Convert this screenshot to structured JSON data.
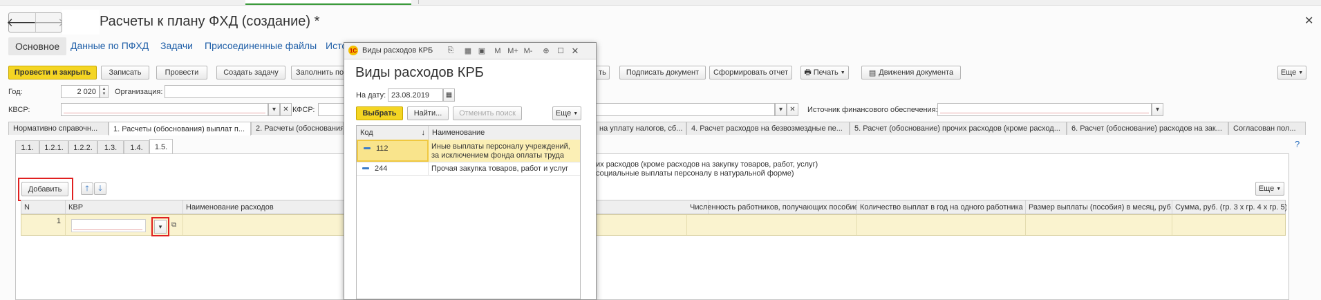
{
  "window": {
    "title": "Расчеты к плану ФХД (создание) *",
    "close_icon": "close-icon"
  },
  "nav": {
    "back": "🡐",
    "forward": "🡒"
  },
  "page_tabs": [
    {
      "label": "Основное",
      "active": true
    },
    {
      "label": "Данные по ПФХД"
    },
    {
      "label": "Задачи"
    },
    {
      "label": "Присоединенные файлы"
    },
    {
      "label": "Исто"
    }
  ],
  "toolbar": {
    "post_close": "Провести и закрыть",
    "save": "Записать",
    "post": "Провести",
    "create_task": "Создать задачу",
    "fill": "Заполнить по",
    "hidden_tail": "ть",
    "sign": "Подписать документ",
    "report": "Сформировать отчет",
    "print": "Печать",
    "movements": "Движения документа",
    "more": "Еще"
  },
  "form": {
    "year_label": "Год:",
    "year_value": "2 020",
    "org_label": "Организация:",
    "kvsr_label": "КВСР:",
    "kfsr_label": "КФСР:",
    "source_label": "Источник финансового обеспечения:"
  },
  "doc_tabs": [
    "Нормативно справочн...",
    "1. Расчеты (обоснования) выплат п...",
    "2. Расчеты (обоснования)",
    "на уплату налогов, сб...",
    "4. Расчет расходов на безвозмездные пе...",
    "5. Расчет (обоснование) прочих расходов (кроме расход...",
    "6. Расчет (обоснование) расходов на зак...",
    "Согласован пол..."
  ],
  "help": "?",
  "sub_tabs": [
    "1.1.",
    "1.2.1.",
    "1.2.2.",
    "1.3.",
    "1.4.",
    "1.5."
  ],
  "description": {
    "line1": "их расходов (кроме расходов на закупку товаров, работ, услуг)",
    "line2": "социальные выплаты персоналу в натуральной форме)"
  },
  "table_toolbar": {
    "add": "Добавить",
    "more": "Еще"
  },
  "grid": {
    "columns": [
      "N",
      "КВР",
      "Наименование расходов",
      "Численность работников, получающих пособие",
      "Количество выплат в год на одного работника",
      "Размер выплаты (пособия) в месяц, руб.",
      "Сумма, руб. (гр. 3 х гр. 4 х гр. 5)"
    ],
    "rows": [
      {
        "n": "1"
      }
    ]
  },
  "modal": {
    "titlebar": "Виды расходов КРБ",
    "heading": "Виды расходов КРБ",
    "date_label": "На дату:",
    "date_value": "23.08.2019",
    "select": "Выбрать",
    "find": "Найти...",
    "cancel_search": "Отменить поиск",
    "more": "Еще",
    "col_code": "Код",
    "col_name": "Наименование",
    "sort_icon": "↓",
    "rows": [
      {
        "code": "112",
        "name": "Иные выплаты персоналу учреждений, за исключением фонда оплаты труда",
        "name1": "Иные выплаты персоналу учреждений,",
        "name2": "за исключением фонда оплаты труда",
        "selected": true
      },
      {
        "code": "244",
        "name": "Прочая закупка товаров, работ и услуг",
        "selected": false
      }
    ],
    "icons": {
      "m": "M",
      "mplus": "M+",
      "mminus": "M-"
    }
  },
  "colors": {
    "accent_yellow": "#f4d523",
    "highlight_row": "#faf3cf",
    "link_blue": "#1f5fa8",
    "red_annotation": "#e02020"
  }
}
